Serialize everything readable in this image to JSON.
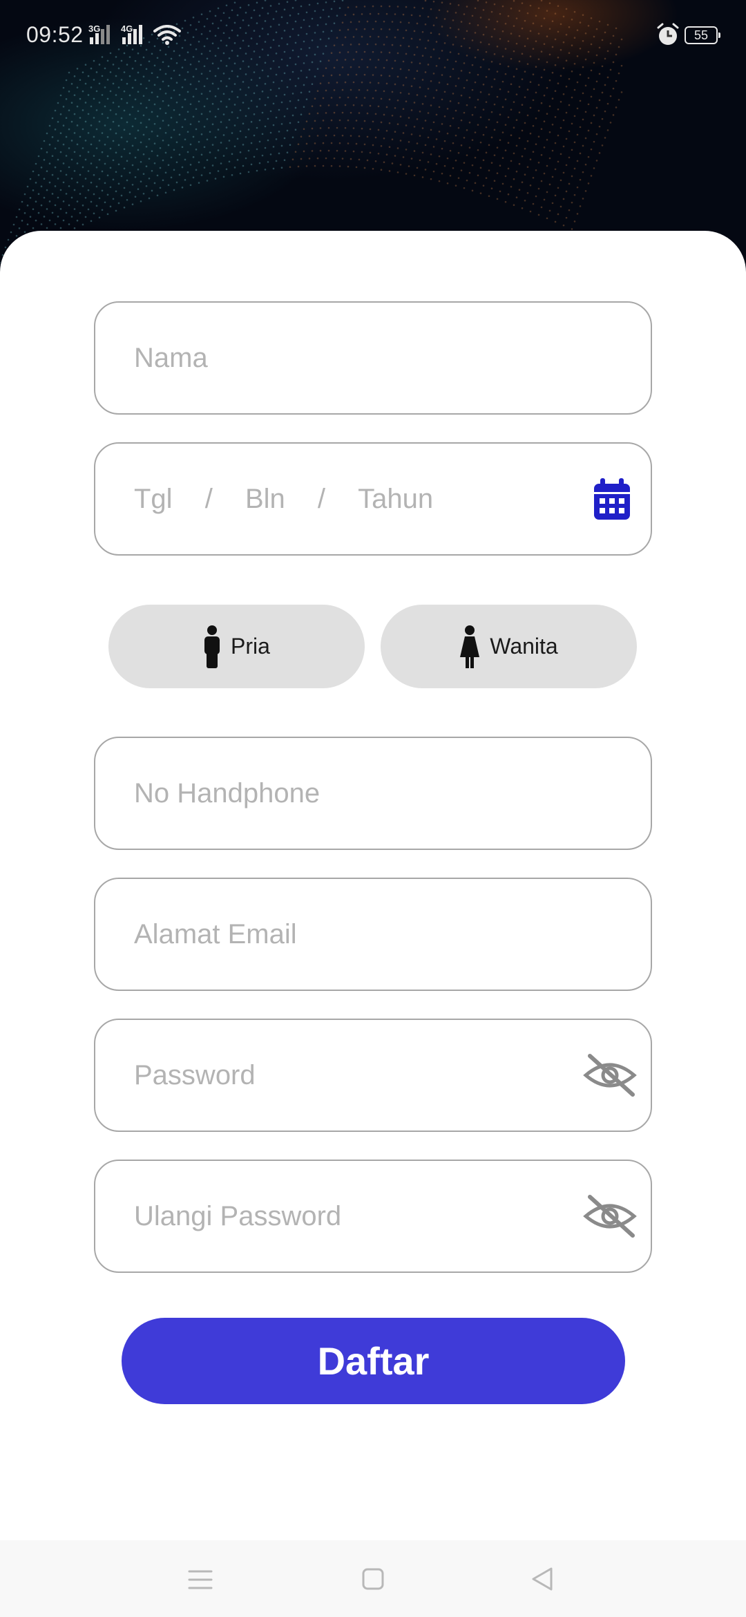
{
  "status_bar": {
    "time": "09:52",
    "signal_1_label": "3G",
    "signal_2_label": "4G",
    "battery": "55",
    "icons": [
      "signal-icon",
      "signal-icon",
      "wifi-icon",
      "alarm-icon",
      "battery-icon"
    ]
  },
  "form": {
    "name_placeholder": "Nama",
    "date": {
      "day": "Tgl",
      "sep1": "/",
      "month": "Bln",
      "sep2": "/",
      "year": "Tahun"
    },
    "gender": {
      "male_label": "Pria",
      "female_label": "Wanita"
    },
    "phone_placeholder": "No Handphone",
    "email_placeholder": "Alamat Email",
    "password_placeholder": "Password",
    "repeat_password_placeholder": "Ulangi Password",
    "submit_label": "Daftar"
  },
  "colors": {
    "accent": "#3f3bd8",
    "calendar_icon": "#2020c8",
    "field_border": "#a7a7a7",
    "placeholder": "#b3b3b3",
    "gender_button_bg": "#e0e0e0"
  },
  "nav_bar": {
    "icons": [
      "menu-icon",
      "home-icon",
      "back-icon"
    ]
  }
}
